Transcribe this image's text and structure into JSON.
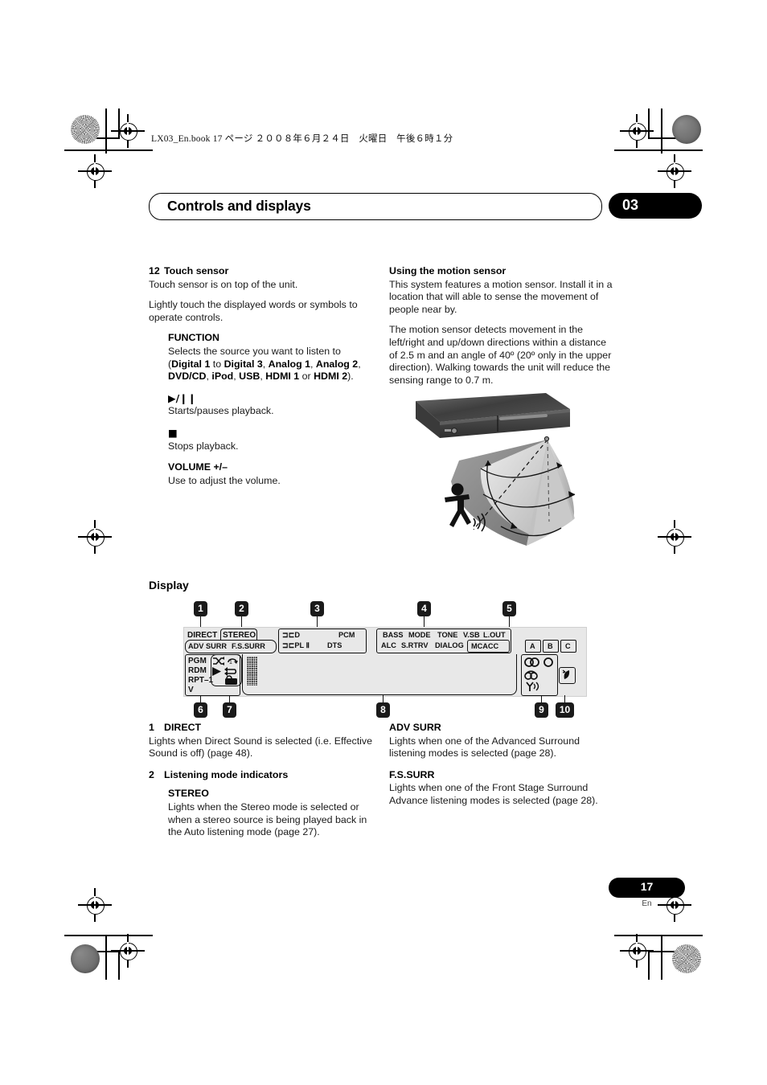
{
  "print": {
    "book_line": "LX03_En.book  17 ページ  ２００８年６月２４日　火曜日　午後６時１分"
  },
  "header": {
    "chapter_title": "Controls and displays",
    "chapter_number": "03"
  },
  "left_column": {
    "item12": {
      "number": "12",
      "title": "Touch sensor",
      "p1": "Touch sensor is on top of the unit.",
      "p2": "Lightly touch the displayed words or symbols to operate controls."
    },
    "function": {
      "title": "FUNCTION",
      "line1": "Selects the source you want to listen to",
      "open_paren": "(",
      "src1": "Digital 1",
      "to": " to ",
      "src2": "Digital 3",
      "c1": ", ",
      "src3": "Analog 1",
      "c2": ", ",
      "src4": "Analog 2",
      "c3": ", ",
      "src5": "DVD/CD",
      "c4": ", ",
      "src6": "iPod",
      "c5": ", ",
      "src7": "USB",
      "c6": ", ",
      "src8": "HDMI 1",
      "or": " or ",
      "src9": "HDMI 2",
      "close_paren": ")."
    },
    "play": {
      "symbol": "▶/❙❙",
      "text": "Starts/pauses playback."
    },
    "stop": {
      "symbol": "■",
      "text": "Stops playback."
    },
    "volume": {
      "title": "VOLUME +/–",
      "text": "Use to adjust the volume."
    }
  },
  "right_column": {
    "motion": {
      "title": "Using the motion sensor",
      "p1": "This system features a motion sensor. Install it in a location that will able to sense the movement of people near by.",
      "p2": "The motion sensor detects movement in the left/right and up/down directions within a distance of 2.5 m and an angle of 40º (20º only in the upper direction). Walking towards the unit will reduce the sensing range to 0.7 m."
    }
  },
  "display_section": {
    "heading": "Display",
    "callouts": [
      "1",
      "2",
      "3",
      "4",
      "5",
      "6",
      "7",
      "8",
      "9",
      "10"
    ],
    "panel": {
      "row_top_left": [
        "DIRECT",
        "STEREO"
      ],
      "row_second_left": [
        "ADV SURR",
        "F.S.SURR"
      ],
      "format_box": {
        "top_left": "⊐⊏D",
        "top_right": "PCM",
        "bottom_left": "⊐⊏PL Ⅱ",
        "bottom_right": "DTS"
      },
      "proc_box": {
        "top": [
          "BASS",
          "MODE",
          "TONE",
          "V.SB",
          "L.OUT"
        ],
        "bottom": [
          "ALC",
          "S.RTRV",
          "DIALOG"
        ],
        "mcacc": "MCACC"
      },
      "abc": [
        "A",
        "B",
        "C"
      ],
      "left_cluster": [
        "PGM",
        "RDM",
        "RPT–1",
        "V"
      ],
      "left_icons": [
        "shuffle-icon",
        "repeat-one-icon",
        "play-icon",
        "repeat-icon",
        "video-icon"
      ],
      "right_icons": [
        "stereo-circles-icon",
        "mono-circle-icon",
        "phones-icon",
        "moon-icon",
        "antenna-icon"
      ],
      "matrix_chars": 14
    }
  },
  "descriptions": {
    "left": [
      {
        "number": "1",
        "term": "DIRECT",
        "body": "Lights when Direct Sound is selected (i.e. Effective Sound is off) (page 48)."
      },
      {
        "number": "2",
        "term": "Listening mode indicators",
        "sub_term": "STEREO",
        "sub_body": "Lights when the Stereo mode is selected or when a stereo source is being played back in the Auto listening mode (page 27)."
      }
    ],
    "right": [
      {
        "term": "ADV SURR",
        "body": "Lights when one of the Advanced Surround listening modes is selected (page 28)."
      },
      {
        "term": "F.S.SURR",
        "body": "Lights when one of the Front Stage Surround Advance listening modes is selected (page 28)."
      }
    ]
  },
  "footer": {
    "page": "17",
    "lang": "En"
  }
}
